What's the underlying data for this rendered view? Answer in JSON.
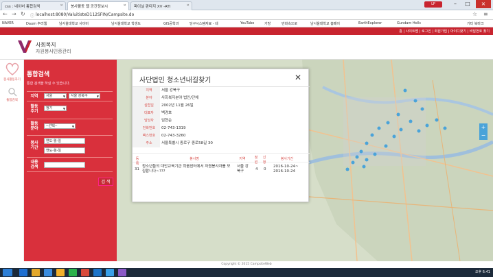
{
  "browser": {
    "tabs": [
      {
        "label": "css : 네이버 통합검색"
      },
      {
        "label": "봉사활동 웹 공간정보시"
      },
      {
        "label": "파이널 판타지 XV -ATI"
      }
    ],
    "profile_label": "LP",
    "url": "localhost:8080/ValuitisteD112SFIN/Campsite.do",
    "bookmarks": [
      "NAVER",
      "Daum 추러웹",
      "남서울대학교 사이버",
      "남서울대학교 학생도",
      "GIS공학과",
      "당구시스템자료 - 네",
      "YouTube",
      "가방",
      "만화속으로",
      "남서울대학교 홈페이",
      "EarthExplorer",
      "Gundam Hollc",
      "기타 북마크"
    ]
  },
  "site": {
    "top_links": "홈 | 사이트맵 | 로그인 | 회원가입 | 아이디찾기 | 비밀번호 찾기",
    "logo_line1": "사회복지",
    "logo_line2": "자원봉사인증관리",
    "rail_items": [
      "봉사활동하기",
      "통합검색"
    ],
    "search_title": "통합검색",
    "search_hint": "통합 검색을 하실 수 있습니다.",
    "labels": {
      "region": "지역",
      "cycle": "활동\n주기",
      "field": "활동\n분야",
      "period": "봉사\n기간",
      "content": "내용\n검색"
    },
    "region_city": "서울",
    "region_district": "서울 강북구",
    "cycle_value": "정기",
    "field_value": "--선택--",
    "date_start_placeholder": "연도-월-일",
    "date_end_placeholder": "연도-월-일",
    "content_value": "",
    "search_button": "검 색",
    "footer": "Copyright © 2015 CampsiteWeb"
  },
  "modal": {
    "title": "사단법인 청소년내길찾기",
    "info": [
      {
        "k": "지역",
        "v": "서울 강북구"
      },
      {
        "k": "분야",
        "v": "사회복지분야 법인/단체"
      },
      {
        "k": "설립일",
        "v": "2002년 11월 26일"
      },
      {
        "k": "대표자",
        "v": "백경호"
      },
      {
        "k": "담당자",
        "v": "임현순"
      },
      {
        "k": "전화번호",
        "v": "02-743-1319"
      },
      {
        "k": "팩스번호",
        "v": "02-743-3260"
      },
      {
        "k": "주소",
        "v": "서울특별시 종로구 종로58길 30"
      }
    ],
    "table_headers": [
      "등록",
      "봉사명",
      "지역",
      "정원",
      "신청",
      "봉사기간"
    ],
    "rows": [
      {
        "no": "31",
        "name": "청소년들의 대안교육기관 희움센터에서 자원봉사자를 모집합니다~???",
        "region": "서울 강북구",
        "capacity": "4",
        "applied": "0",
        "period": "2016-10-24~ 2016-10-24"
      }
    ]
  },
  "taskbar": {
    "time": "오후 6:41"
  },
  "colors": {
    "brand_red": "#d9303c",
    "accent_red": "#c8242f",
    "label_red": "#d9534f"
  }
}
